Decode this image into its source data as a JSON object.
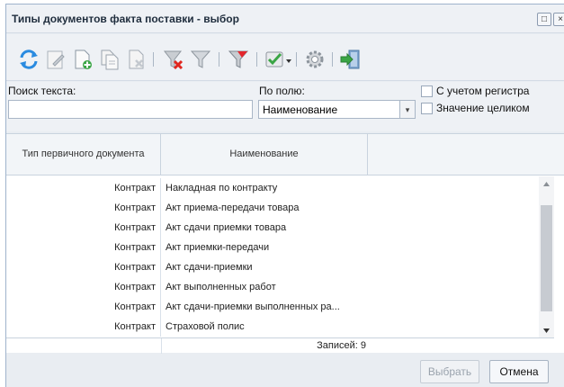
{
  "window": {
    "title": "Типы документов факта поставки - выбор",
    "restore_glyph": "□",
    "close_glyph": "×"
  },
  "toolbar": {
    "icons": [
      "refresh-icon",
      "edit-icon",
      "add-icon",
      "copy-icon",
      "delete-icon",
      "clear-filter-icon",
      "filter-icon",
      "filter-settings-icon",
      "check-dropdown-icon",
      "gear-icon",
      "exit-icon"
    ]
  },
  "search": {
    "text_label": "Поиск текста:",
    "text_value": "",
    "field_label": "По полю:",
    "field_value": "Наименование",
    "case_label": "С учетом регистра",
    "whole_label": "Значение целиком",
    "case_checked": false,
    "whole_checked": false
  },
  "grid": {
    "columns": [
      "Тип первичного документа",
      "Наименование"
    ],
    "rows": [
      {
        "type": "Контракт",
        "name": "Накладная по контракту"
      },
      {
        "type": "Контракт",
        "name": "Акт приема-передачи товара"
      },
      {
        "type": "Контракт",
        "name": "Акт сдачи приемки товара"
      },
      {
        "type": "Контракт",
        "name": "Акт приемки-передачи"
      },
      {
        "type": "Контракт",
        "name": "Акт сдачи-приемки"
      },
      {
        "type": "Контракт",
        "name": "Акт выполненных работ"
      },
      {
        "type": "Контракт",
        "name": "Акт сдачи-приемки выполненных ра..."
      },
      {
        "type": "Контракт",
        "name": "Страховой полис"
      }
    ],
    "records_label": "Записей: 9"
  },
  "buttons": {
    "select_label": "Выбрать",
    "cancel_label": "Отмена"
  },
  "colors": {
    "border": "#9fb3cc",
    "panel": "#eef1f5",
    "grid_line": "#c9d3de"
  }
}
